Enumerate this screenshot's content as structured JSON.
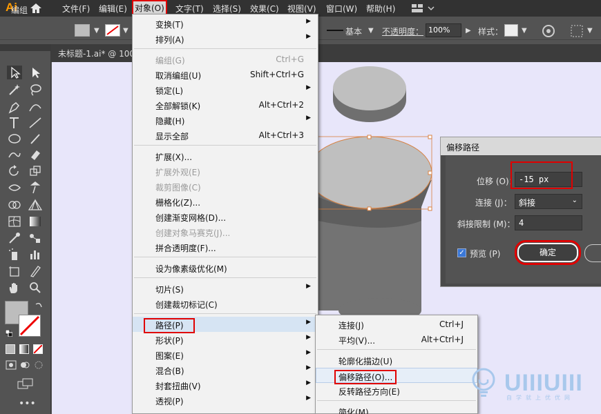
{
  "app": {
    "logo": "Ai"
  },
  "menubar": {
    "items": [
      "文件(F)",
      "编辑(E)",
      "对象(O)",
      "文字(T)",
      "选择(S)",
      "效果(C)",
      "视图(V)",
      "窗口(W)",
      "帮助(H)"
    ]
  },
  "controlbar": {
    "label": "编组",
    "stroke_style": "基本",
    "opacity_label": "不透明度：",
    "opacity_value": "100%",
    "style_label": "样式："
  },
  "document": {
    "tab_title": "未标题-1.ai* @ 100"
  },
  "object_menu": {
    "items": [
      {
        "label": "变换(T)",
        "shortcut": "",
        "submenu": true,
        "disabled": false
      },
      {
        "label": "排列(A)",
        "shortcut": "",
        "submenu": true,
        "disabled": false
      },
      {
        "label": "编组(G)",
        "shortcut": "Ctrl+G",
        "submenu": false,
        "disabled": true
      },
      {
        "label": "取消编组(U)",
        "shortcut": "Shift+Ctrl+G",
        "submenu": false,
        "disabled": false
      },
      {
        "label": "锁定(L)",
        "shortcut": "",
        "submenu": true,
        "disabled": false
      },
      {
        "label": "全部解锁(K)",
        "shortcut": "Alt+Ctrl+2",
        "submenu": false,
        "disabled": false
      },
      {
        "label": "隐藏(H)",
        "shortcut": "",
        "submenu": true,
        "disabled": false
      },
      {
        "label": "显示全部",
        "shortcut": "Alt+Ctrl+3",
        "submenu": false,
        "disabled": false
      },
      {
        "label": "扩展(X)...",
        "shortcut": "",
        "submenu": false,
        "disabled": false
      },
      {
        "label": "扩展外观(E)",
        "shortcut": "",
        "submenu": false,
        "disabled": true
      },
      {
        "label": "裁剪图像(C)",
        "shortcut": "",
        "submenu": false,
        "disabled": true
      },
      {
        "label": "栅格化(Z)...",
        "shortcut": "",
        "submenu": false,
        "disabled": false
      },
      {
        "label": "创建渐变网格(D)...",
        "shortcut": "",
        "submenu": false,
        "disabled": false
      },
      {
        "label": "创建对象马赛克(J)...",
        "shortcut": "",
        "submenu": false,
        "disabled": true
      },
      {
        "label": "拼合透明度(F)...",
        "shortcut": "",
        "submenu": false,
        "disabled": false
      },
      {
        "label": "设为像素级优化(M)",
        "shortcut": "",
        "submenu": false,
        "disabled": false
      },
      {
        "label": "切片(S)",
        "shortcut": "",
        "submenu": true,
        "disabled": false
      },
      {
        "label": "创建裁切标记(C)",
        "shortcut": "",
        "submenu": false,
        "disabled": false
      },
      {
        "label": "路径(P)",
        "shortcut": "",
        "submenu": true,
        "disabled": false
      },
      {
        "label": "形状(P)",
        "shortcut": "",
        "submenu": true,
        "disabled": false
      },
      {
        "label": "图案(E)",
        "shortcut": "",
        "submenu": true,
        "disabled": false
      },
      {
        "label": "混合(B)",
        "shortcut": "",
        "submenu": true,
        "disabled": false
      },
      {
        "label": "封套扭曲(V)",
        "shortcut": "",
        "submenu": true,
        "disabled": false
      },
      {
        "label": "透视(P)",
        "shortcut": "",
        "submenu": true,
        "disabled": false
      }
    ]
  },
  "path_submenu": {
    "items": [
      {
        "label": "连接(J)",
        "shortcut": "Ctrl+J"
      },
      {
        "label": "平均(V)...",
        "shortcut": "Alt+Ctrl+J"
      },
      {
        "label": "轮廓化描边(U)",
        "shortcut": ""
      },
      {
        "label": "偏移路径(O)...",
        "shortcut": ""
      },
      {
        "label": "反转路径方向(E)",
        "shortcut": ""
      },
      {
        "label": "简化(M)...",
        "shortcut": ""
      }
    ]
  },
  "offset_dialog": {
    "title": "偏移路径",
    "offset_label": "位移 (O)：",
    "offset_value": "-15 px",
    "joins_label": "连接 (J)：",
    "joins_value": "斜接",
    "miter_label": "斜接限制 (M)：",
    "miter_value": "4",
    "preview_label": "预览 (P)",
    "preview_checked": true,
    "ok_label": "确定"
  },
  "watermark": {
    "logo": "UIIIUIII",
    "sub": "自学就上优优网"
  },
  "colors": {
    "accent_red": "#e00000",
    "canvas": "#e8e6fa",
    "logo_orange": "#ff9a00"
  }
}
